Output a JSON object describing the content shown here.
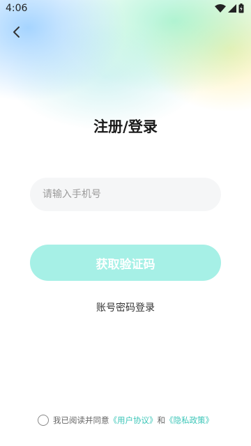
{
  "status_bar": {
    "time": "4:06",
    "icons": [
      "wifi-icon",
      "signal-icon",
      "battery-icon"
    ]
  },
  "nav": {
    "back_icon": "chevron-left-icon"
  },
  "page": {
    "title": "注册/登录"
  },
  "form": {
    "phone_placeholder": "请输入手机号",
    "phone_value": "",
    "get_code_label": "获取验证码",
    "password_login_label": "账号密码登录"
  },
  "agreement": {
    "prefix": "我已阅读并同意",
    "user_agreement": "《用户协议》",
    "conjunction": "和",
    "privacy_policy": "《隐私政策》",
    "checked": false
  },
  "colors": {
    "accent": "#3cc6b8",
    "button_disabled": "#a6f0e6",
    "input_bg": "#f5f6f7"
  }
}
